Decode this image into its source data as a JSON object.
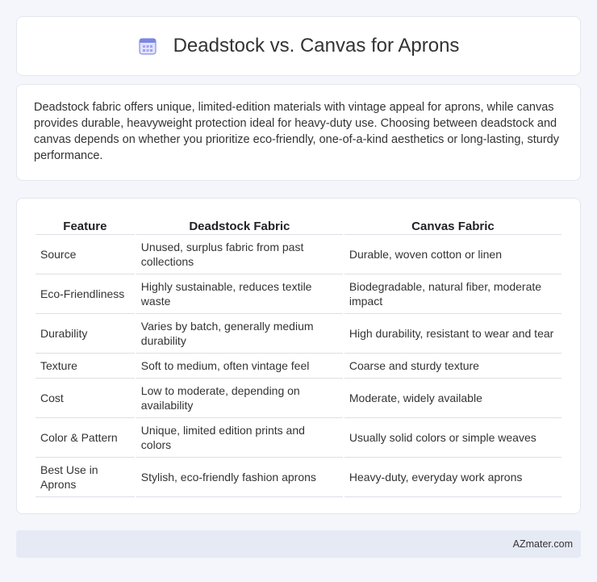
{
  "header": {
    "title": "Deadstock vs. Canvas for Aprons",
    "icon": "calendar-icon"
  },
  "intro": {
    "text": "Deadstock fabric offers unique, limited-edition materials with vintage appeal for aprons, while canvas provides durable, heavyweight protection ideal for heavy-duty use. Choosing between deadstock and canvas depends on whether you prioritize eco-friendly, one-of-a-kind aesthetics or long-lasting, sturdy performance."
  },
  "table": {
    "headers": [
      "Feature",
      "Deadstock Fabric",
      "Canvas Fabric"
    ],
    "rows": [
      [
        "Source",
        "Unused, surplus fabric from past collections",
        "Durable, woven cotton or linen"
      ],
      [
        "Eco-Friendliness",
        "Highly sustainable, reduces textile waste",
        "Biodegradable, natural fiber, moderate impact"
      ],
      [
        "Durability",
        "Varies by batch, generally medium durability",
        "High durability, resistant to wear and tear"
      ],
      [
        "Texture",
        "Soft to medium, often vintage feel",
        "Coarse and sturdy texture"
      ],
      [
        "Cost",
        "Low to moderate, depending on availability",
        "Moderate, widely available"
      ],
      [
        "Color & Pattern",
        "Unique, limited edition prints and colors",
        "Usually solid colors or simple weaves"
      ],
      [
        "Best Use in Aprons",
        "Stylish, eco-friendly fashion aprons",
        "Heavy-duty, everyday work aprons"
      ]
    ]
  },
  "footer": {
    "text": "AZmater.com"
  },
  "colors": {
    "page_bg": "#f4f6fb",
    "footer_bg": "#e5eaf5",
    "icon_accent": "#8a7fd8"
  }
}
